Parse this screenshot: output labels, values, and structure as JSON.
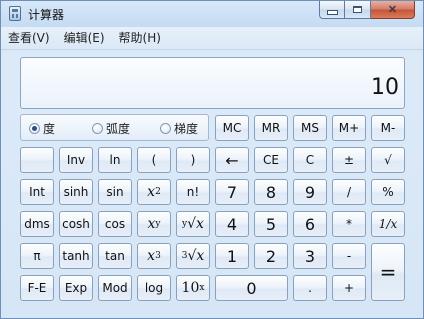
{
  "window": {
    "title": "计算器"
  },
  "menu": [
    "查看(V)",
    "编辑(E)",
    "帮助(H)"
  ],
  "display": {
    "value": "10"
  },
  "angle": {
    "options": [
      "度",
      "弧度",
      "梯度"
    ],
    "selected": 0
  },
  "buttons": {
    "mc": "MC",
    "mr": "MR",
    "ms": "MS",
    "m_plus": "M+",
    "m_minus": "M-",
    "inv": "Inv",
    "ln": "ln",
    "lparen": "(",
    "rparen": ")",
    "backspace": "←",
    "ce": "CE",
    "c": "C",
    "plusminus": "±",
    "sqrt": "√",
    "int": "Int",
    "sinh": "sinh",
    "sin": "sin",
    "x2_base": "x",
    "x2_sup": "2",
    "factorial": "n!",
    "seven": "7",
    "eight": "8",
    "nine": "9",
    "divide": "/",
    "percent": "%",
    "dms": "dms",
    "cosh": "cosh",
    "cos": "cos",
    "xy_base": "x",
    "xy_sup": "y",
    "yroot_sup": "y",
    "yroot_sym": "√",
    "yroot_x": "x",
    "four": "4",
    "five": "5",
    "six": "6",
    "multiply": "*",
    "reciprocal": "1/x",
    "pi": "π",
    "tanh": "tanh",
    "tan": "tan",
    "x3_base": "x",
    "x3_sup": "3",
    "cuberoot_sup": "3",
    "cuberoot_sym": "√",
    "cuberoot_x": "x",
    "one": "1",
    "two": "2",
    "three": "3",
    "subtract": "-",
    "equals": "=",
    "fe": "F-E",
    "exp": "Exp",
    "mod": "Mod",
    "log": "log",
    "tenx_base": "10",
    "tenx_sup": "x",
    "zero": "0",
    "decimal": ".",
    "add": "+"
  },
  "icons": {
    "app": "calculator-icon",
    "minimize": "minimize-icon",
    "maximize": "maximize-icon",
    "close": "close-icon",
    "close_glyph": "✕"
  }
}
